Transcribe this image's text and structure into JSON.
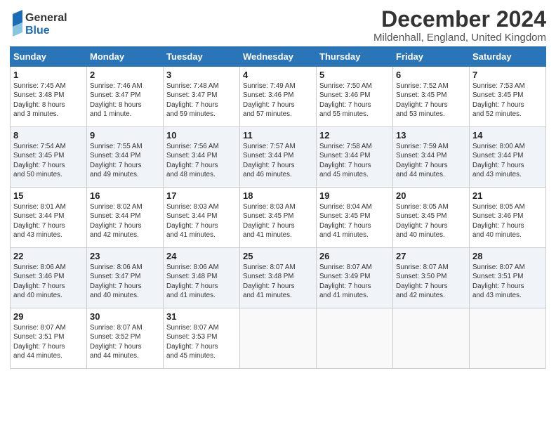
{
  "header": {
    "logo_general": "General",
    "logo_blue": "Blue",
    "title": "December 2024",
    "subtitle": "Mildenhall, England, United Kingdom"
  },
  "calendar": {
    "columns": [
      "Sunday",
      "Monday",
      "Tuesday",
      "Wednesday",
      "Thursday",
      "Friday",
      "Saturday"
    ],
    "weeks": [
      [
        {
          "day": "",
          "sunrise": "",
          "sunset": "",
          "daylight": "",
          "empty": true
        },
        {
          "day": "",
          "sunrise": "",
          "sunset": "",
          "daylight": "",
          "empty": true
        },
        {
          "day": "",
          "sunrise": "",
          "sunset": "",
          "daylight": "",
          "empty": true
        },
        {
          "day": "",
          "sunrise": "",
          "sunset": "",
          "daylight": "",
          "empty": true
        },
        {
          "day": "",
          "sunrise": "",
          "sunset": "",
          "daylight": "",
          "empty": true
        },
        {
          "day": "",
          "sunrise": "",
          "sunset": "",
          "daylight": "",
          "empty": true
        },
        {
          "day": "1",
          "sunrise": "Sunrise: 7:45 AM",
          "sunset": "Sunset: 3:48 PM",
          "daylight": "Daylight: 8 hours and 3 minutes.",
          "empty": false
        }
      ],
      [
        {
          "day": "2",
          "sunrise": "Sunrise: 7:46 AM",
          "sunset": "Sunset: 3:47 PM",
          "daylight": "Daylight: 8 hours and 1 minute.",
          "empty": false
        },
        {
          "day": "3",
          "sunrise": "Sunrise: 7:48 AM",
          "sunset": "Sunset: 3:47 PM",
          "daylight": "Daylight: 7 hours and 59 minutes.",
          "empty": false
        },
        {
          "day": "4",
          "sunrise": "Sunrise: 7:49 AM",
          "sunset": "Sunset: 3:46 PM",
          "daylight": "Daylight: 7 hours and 57 minutes.",
          "empty": false
        },
        {
          "day": "5",
          "sunrise": "Sunrise: 7:50 AM",
          "sunset": "Sunset: 3:46 PM",
          "daylight": "Daylight: 7 hours and 55 minutes.",
          "empty": false
        },
        {
          "day": "6",
          "sunrise": "Sunrise: 7:52 AM",
          "sunset": "Sunset: 3:45 PM",
          "daylight": "Daylight: 7 hours and 53 minutes.",
          "empty": false
        },
        {
          "day": "7",
          "sunrise": "Sunrise: 7:53 AM",
          "sunset": "Sunset: 3:45 PM",
          "daylight": "Daylight: 7 hours and 52 minutes.",
          "empty": false
        },
        {
          "day": "8",
          "sunrise": "Sunrise: 7:54 AM",
          "sunset": "Sunset: 3:45 PM",
          "daylight": "Daylight: 7 hours and 50 minutes.",
          "empty": false
        }
      ],
      [
        {
          "day": "9",
          "sunrise": "Sunrise: 7:55 AM",
          "sunset": "Sunset: 3:44 PM",
          "daylight": "Daylight: 7 hours and 49 minutes.",
          "empty": false
        },
        {
          "day": "10",
          "sunrise": "Sunrise: 7:56 AM",
          "sunset": "Sunset: 3:44 PM",
          "daylight": "Daylight: 7 hours and 48 minutes.",
          "empty": false
        },
        {
          "day": "11",
          "sunrise": "Sunrise: 7:57 AM",
          "sunset": "Sunset: 3:44 PM",
          "daylight": "Daylight: 7 hours and 46 minutes.",
          "empty": false
        },
        {
          "day": "12",
          "sunrise": "Sunrise: 7:58 AM",
          "sunset": "Sunset: 3:44 PM",
          "daylight": "Daylight: 7 hours and 45 minutes.",
          "empty": false
        },
        {
          "day": "13",
          "sunrise": "Sunrise: 7:59 AM",
          "sunset": "Sunset: 3:44 PM",
          "daylight": "Daylight: 7 hours and 44 minutes.",
          "empty": false
        },
        {
          "day": "14",
          "sunrise": "Sunrise: 8:00 AM",
          "sunset": "Sunset: 3:44 PM",
          "daylight": "Daylight: 7 hours and 43 minutes.",
          "empty": false
        },
        {
          "day": "15",
          "sunrise": "Sunrise: 8:01 AM",
          "sunset": "Sunset: 3:44 PM",
          "daylight": "Daylight: 7 hours and 43 minutes.",
          "empty": false
        }
      ],
      [
        {
          "day": "16",
          "sunrise": "Sunrise: 8:02 AM",
          "sunset": "Sunset: 3:44 PM",
          "daylight": "Daylight: 7 hours and 42 minutes.",
          "empty": false
        },
        {
          "day": "17",
          "sunrise": "Sunrise: 8:03 AM",
          "sunset": "Sunset: 3:44 PM",
          "daylight": "Daylight: 7 hours and 41 minutes.",
          "empty": false
        },
        {
          "day": "18",
          "sunrise": "Sunrise: 8:03 AM",
          "sunset": "Sunset: 3:45 PM",
          "daylight": "Daylight: 7 hours and 41 minutes.",
          "empty": false
        },
        {
          "day": "19",
          "sunrise": "Sunrise: 8:04 AM",
          "sunset": "Sunset: 3:45 PM",
          "daylight": "Daylight: 7 hours and 41 minutes.",
          "empty": false
        },
        {
          "day": "20",
          "sunrise": "Sunrise: 8:05 AM",
          "sunset": "Sunset: 3:45 PM",
          "daylight": "Daylight: 7 hours and 40 minutes.",
          "empty": false
        },
        {
          "day": "21",
          "sunrise": "Sunrise: 8:05 AM",
          "sunset": "Sunset: 3:46 PM",
          "daylight": "Daylight: 7 hours and 40 minutes.",
          "empty": false
        },
        {
          "day": "22",
          "sunrise": "Sunrise: 8:06 AM",
          "sunset": "Sunset: 3:46 PM",
          "daylight": "Daylight: 7 hours and 40 minutes.",
          "empty": false
        }
      ],
      [
        {
          "day": "23",
          "sunrise": "Sunrise: 8:06 AM",
          "sunset": "Sunset: 3:47 PM",
          "daylight": "Daylight: 7 hours and 40 minutes.",
          "empty": false
        },
        {
          "day": "24",
          "sunrise": "Sunrise: 8:06 AM",
          "sunset": "Sunset: 3:48 PM",
          "daylight": "Daylight: 7 hours and 41 minutes.",
          "empty": false
        },
        {
          "day": "25",
          "sunrise": "Sunrise: 8:07 AM",
          "sunset": "Sunset: 3:48 PM",
          "daylight": "Daylight: 7 hours and 41 minutes.",
          "empty": false
        },
        {
          "day": "26",
          "sunrise": "Sunrise: 8:07 AM",
          "sunset": "Sunset: 3:49 PM",
          "daylight": "Daylight: 7 hours and 41 minutes.",
          "empty": false
        },
        {
          "day": "27",
          "sunrise": "Sunrise: 8:07 AM",
          "sunset": "Sunset: 3:50 PM",
          "daylight": "Daylight: 7 hours and 42 minutes.",
          "empty": false
        },
        {
          "day": "28",
          "sunrise": "Sunrise: 8:07 AM",
          "sunset": "Sunset: 3:51 PM",
          "daylight": "Daylight: 7 hours and 43 minutes.",
          "empty": false
        },
        {
          "day": "29",
          "sunrise": "Sunrise: 8:07 AM",
          "sunset": "Sunset: 3:51 PM",
          "daylight": "Daylight: 7 hours and 44 minutes.",
          "empty": false
        }
      ],
      [
        {
          "day": "30",
          "sunrise": "Sunrise: 8:07 AM",
          "sunset": "Sunset: 3:52 PM",
          "daylight": "Daylight: 7 hours and 44 minutes.",
          "empty": false
        },
        {
          "day": "31",
          "sunrise": "Sunrise: 8:07 AM",
          "sunset": "Sunset: 3:53 PM",
          "daylight": "Daylight: 7 hours and 45 minutes.",
          "empty": false
        },
        {
          "day": "",
          "sunrise": "",
          "sunset": "",
          "daylight": "",
          "empty": true
        },
        {
          "day": "",
          "sunrise": "",
          "sunset": "",
          "daylight": "",
          "empty": true
        },
        {
          "day": "",
          "sunrise": "",
          "sunset": "",
          "daylight": "",
          "empty": true
        },
        {
          "day": "",
          "sunrise": "",
          "sunset": "",
          "daylight": "",
          "empty": true
        },
        {
          "day": "",
          "sunrise": "",
          "sunset": "",
          "daylight": "",
          "empty": true
        }
      ]
    ]
  }
}
